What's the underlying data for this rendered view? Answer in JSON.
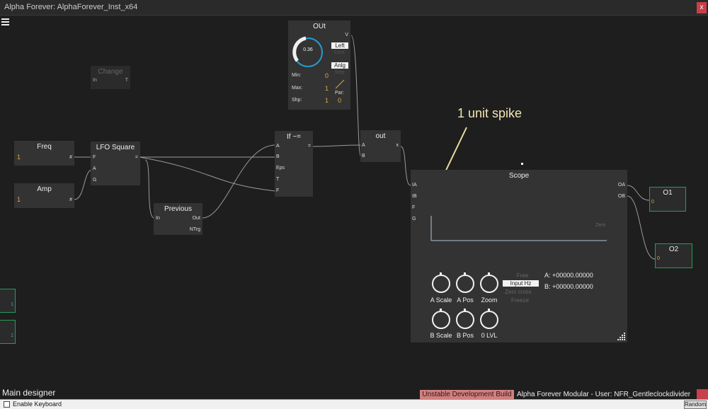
{
  "window": {
    "title": "Alpha Forever: AlphaForever_Inst_x64",
    "close_label": "x"
  },
  "menu_icon": "hamburger-menu-icon",
  "nodes": {
    "change": {
      "title": "Change",
      "in": "In",
      "out": "T"
    },
    "freq": {
      "title": "Freq",
      "value": "1",
      "out": "#"
    },
    "amp": {
      "title": "Amp",
      "value": "1",
      "out": "#"
    },
    "lfo": {
      "title": "LFO Square",
      "in_f": "F",
      "in_a": "A",
      "in_g": "G",
      "out": "="
    },
    "previous": {
      "title": "Previous",
      "in": "In",
      "out": "Out",
      "ntrg": "NTrg"
    },
    "if": {
      "title": "If ~=",
      "a": "A",
      "b": "B",
      "eps": "Eps",
      "t": "T",
      "f": "F",
      "out": "="
    },
    "out_small": {
      "title": "out",
      "a": "A",
      "b": "B",
      "out": "x"
    },
    "out_main": {
      "title": "OUt",
      "knob_value": "0.36",
      "v_port": "V",
      "left": "Left",
      "cent": "Cent",
      "anlg": "Anlg",
      "step": "Step",
      "par": "Par:",
      "min_label": "Min:",
      "min_val": "0",
      "max_label": "Max:",
      "max_val": "1",
      "shp_label": "Shp:",
      "shp_val": "1",
      "shp_val2": "0"
    },
    "scope": {
      "title": "Scope",
      "ports": [
        "IA",
        "IB",
        "F",
        "G"
      ],
      "outs": [
        "OA",
        "OB"
      ],
      "zero": "Zero",
      "modes": [
        "Free",
        "Input Hz",
        "Zero cross",
        "Freeze"
      ],
      "selected_mode": "Input Hz",
      "readout_a": "A: +00000.00000",
      "readout_b": "B: +00000.00000",
      "knobs_row1": [
        "A Scale",
        "A Pos",
        "Zoom"
      ],
      "knobs_row2": [
        "B Scale",
        "B Pos",
        "0 LVL"
      ]
    },
    "o1": {
      "title": "O1",
      "value": "0"
    },
    "o2": {
      "title": "O2",
      "value": "0"
    },
    "side1": {
      "value": "1"
    },
    "side2": {
      "value": "1"
    }
  },
  "annotation": {
    "text": "1 unit spike"
  },
  "bottom": {
    "label": "Main designer",
    "badge": "Unstable Development Build",
    "status": "Alpha Forever Modular - User: NFR_Gentleclockdivider"
  },
  "footer": {
    "checkbox_label": "Enable Keyboard",
    "random": "Random"
  },
  "colors": {
    "accent": "#2a9ad0",
    "value": "#e0a840",
    "highlight": "#e8dca0",
    "close": "#c8404a"
  }
}
